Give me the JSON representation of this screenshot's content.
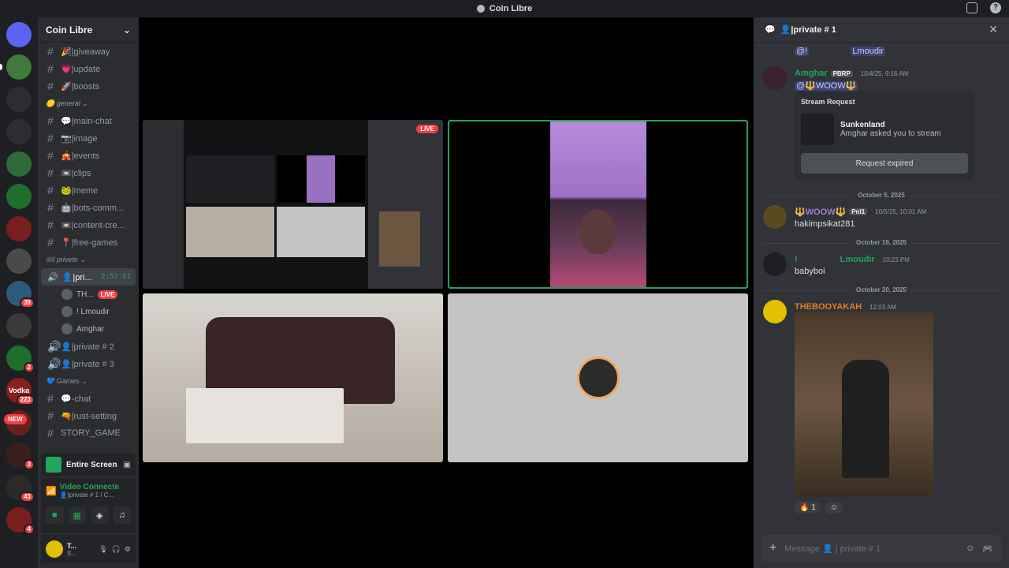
{
  "window": {
    "title": "Coin Libre"
  },
  "servers": [
    {
      "name": "discord-home",
      "label": "",
      "color": "#5865f2"
    },
    {
      "name": "server-1",
      "label": "",
      "color": "#3f7a3a",
      "pill": true
    },
    {
      "name": "server-2",
      "label": "",
      "color": "#2b2d31"
    },
    {
      "name": "server-3",
      "label": "",
      "color": "#2b2d31"
    },
    {
      "name": "server-4",
      "label": "",
      "color": "#2f6b3a"
    },
    {
      "name": "server-5",
      "label": "",
      "color": "#1f6e2c"
    },
    {
      "name": "server-6",
      "label": "",
      "color": "#7a1f1f"
    },
    {
      "name": "server-7",
      "label": "",
      "color": "#4a4a4a"
    },
    {
      "name": "server-8",
      "label": "",
      "color": "#2b5a7a",
      "badge": "39"
    },
    {
      "name": "server-9",
      "label": "",
      "color": "#3a3a3a"
    },
    {
      "name": "server-10",
      "label": "",
      "color": "#1f6e2c",
      "badge": "2"
    },
    {
      "name": "server-11",
      "label": "Vodka",
      "color": "#8a1f1f",
      "badge": "223"
    },
    {
      "name": "server-12",
      "label": "",
      "color": "#6a1f1f"
    },
    {
      "name": "server-13",
      "label": "",
      "color": "#3a1f1f",
      "badge": "3"
    },
    {
      "name": "server-14",
      "label": "",
      "color": "#2a2a2a",
      "badge": "43"
    },
    {
      "name": "server-15",
      "label": "",
      "color": "#7a1f1f",
      "badge": "4"
    }
  ],
  "new_pill": "NEW",
  "guild": {
    "name": "Coin Libre"
  },
  "channels": [
    {
      "type": "text",
      "label": "🎉|giveaway"
    },
    {
      "type": "text",
      "label": "💗|update"
    },
    {
      "type": "text",
      "label": "🚀|boosts"
    },
    {
      "type": "category",
      "label": "🟡 general"
    },
    {
      "type": "text",
      "label": "💬|main-chat"
    },
    {
      "type": "text",
      "label": "📷|image"
    },
    {
      "type": "text",
      "label": "🎪|events"
    },
    {
      "type": "text",
      "label": "📼|clips"
    },
    {
      "type": "text",
      "label": "🐸|meme"
    },
    {
      "type": "text",
      "label": "🤖|bots-comm..."
    },
    {
      "type": "text",
      "label": "📼|content-cre..."
    },
    {
      "type": "text",
      "label": "📍|free-games"
    },
    {
      "type": "category",
      "label": "🎟 privete"
    }
  ],
  "active_voice": {
    "label": "👤|pri...",
    "timer": "2:52:01"
  },
  "voice_users": [
    {
      "name": "TH...",
      "live": "LIVE"
    },
    {
      "name": "! Lmoudir",
      "live": ""
    },
    {
      "name": "Amghar",
      "live": ""
    }
  ],
  "channels_after": [
    {
      "type": "voice",
      "label": "👤|private # 2"
    },
    {
      "type": "voice",
      "label": "👤|private # 3"
    },
    {
      "type": "category",
      "label": "💙 Games"
    },
    {
      "type": "text",
      "label": "💬-chat"
    },
    {
      "type": "text",
      "label": "🔫|rust-setting"
    },
    {
      "type": "text",
      "label": "STORY_GAME"
    }
  ],
  "stream_panel": {
    "label": "Entire Screen"
  },
  "voice_panel": {
    "title": "Video Connecte",
    "subtitle": "👤|private # 1 / C..."
  },
  "user_panel": {
    "name": "T...",
    "status": "S..."
  },
  "stage": {
    "live_label": "LIVE"
  },
  "chat": {
    "header": "👤|private # 1",
    "top_mention_a": "@!",
    "top_mention_b": "Lmoudir",
    "msg1": {
      "author": "Amghar",
      "tag": "PBRP",
      "time": "10/4/25, 9:16 AM",
      "text": "@🔱WOOW🔱"
    },
    "stream_card": {
      "title": "Stream Request",
      "name": "Sunkenland",
      "sub": "Amghar asked you to stream",
      "button": "Request expired"
    },
    "div1": "October 5, 2025",
    "msg2": {
      "author": "🔱WOOW🔱",
      "tag": "Pnl1",
      "time": "10/5/25, 10:01 AM",
      "text": "hakimpsikat281"
    },
    "div2": "October 19, 2025",
    "msg3": {
      "author": "!",
      "author2": "Lmoudir",
      "time": "10:23 PM",
      "text": "babyboi"
    },
    "div3": "October 20, 2025",
    "msg4": {
      "author": "THEBOOYAKAH",
      "time": "12:03 AM"
    },
    "reaction_count": "1",
    "composer_placeholder": "Message 👤 | private # 1"
  },
  "colors": {
    "accent_green": "#23a55a",
    "live_red": "#f23f43",
    "mention": "#c9cdfb"
  }
}
